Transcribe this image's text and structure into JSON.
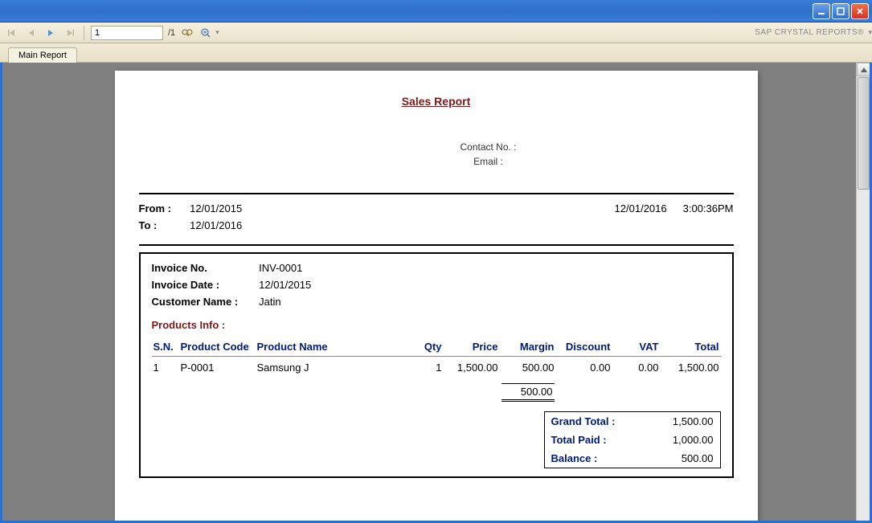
{
  "toolbar": {
    "current_page": "1",
    "total_pages": "/1",
    "brand": "SAP CRYSTAL REPORTS®"
  },
  "tabs": {
    "main": "Main Report"
  },
  "report": {
    "title": "Sales Report",
    "contact_label": "Contact No. :",
    "email_label": "Email :",
    "from_label": "From :",
    "from_value": "12/01/2015",
    "to_label": "To :",
    "to_value": "12/01/2016",
    "print_date": "12/01/2016",
    "print_time": "3:00:36PM",
    "inv_no_label": "Invoice No.",
    "inv_no": "INV-0001",
    "inv_date_label": "Invoice Date :",
    "inv_date": "12/01/2015",
    "cust_label": "Customer Name :",
    "cust_name": "Jatin",
    "products_label": "Products Info :",
    "headers": {
      "sn": "S.N.",
      "code": "Product Code",
      "name": "Product Name",
      "qty": "Qty",
      "price": "Price",
      "margin": "Margin",
      "discount": "Discount",
      "vat": "VAT",
      "total": "Total"
    },
    "row": {
      "sn": "1",
      "code": "P-0001",
      "name": "Samsung J",
      "qty": "1",
      "price": "1,500.00",
      "margin": "500.00",
      "discount": "0.00",
      "vat": "0.00",
      "total": "1,500.00"
    },
    "margin_subtotal": "500.00",
    "totals": {
      "grand_label": "Grand Total :",
      "grand": "1,500.00",
      "paid_label": "Total Paid :",
      "paid": "1,000.00",
      "balance_label": "Balance :",
      "balance": "500.00"
    }
  }
}
